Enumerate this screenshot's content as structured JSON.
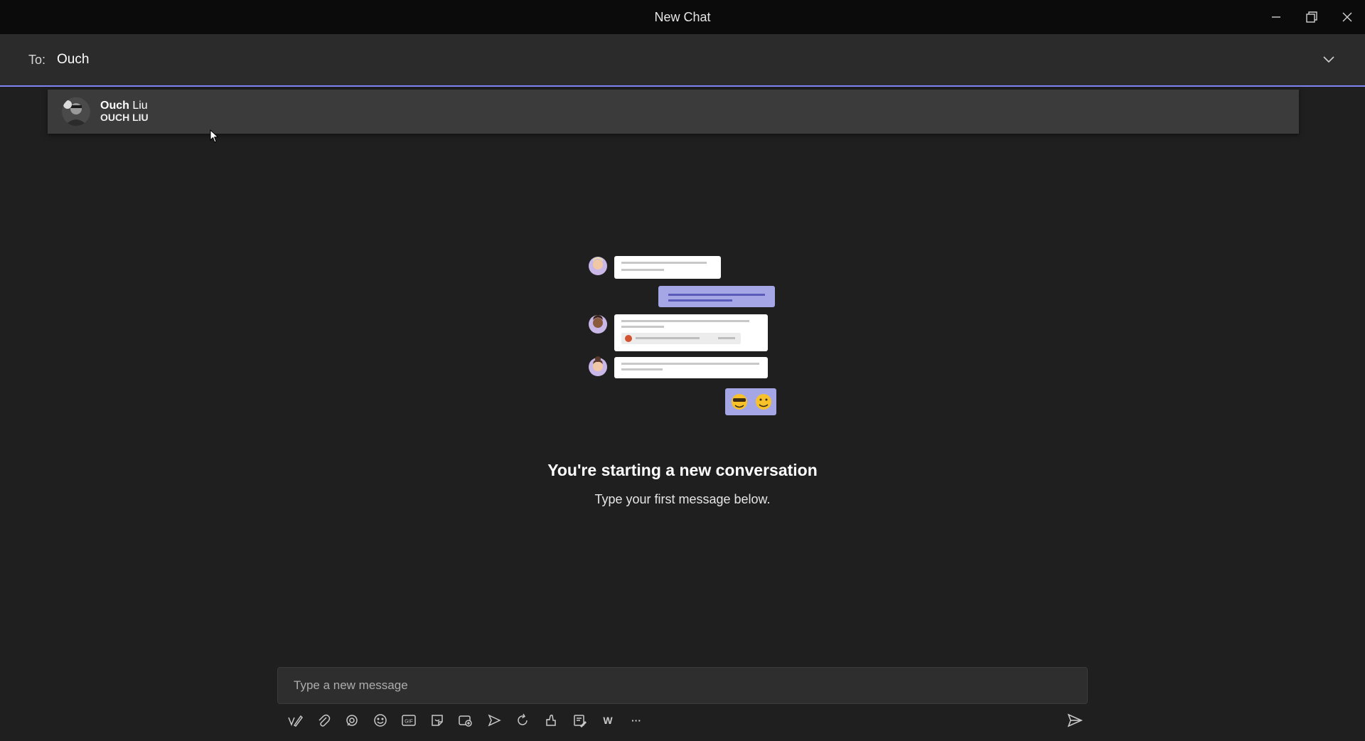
{
  "window": {
    "title": "New Chat"
  },
  "to_bar": {
    "label": "To:",
    "value": "Ouch"
  },
  "suggestion": {
    "name_match": "Ouch",
    "name_rest": " Liu",
    "subtitle": "OUCH LIU"
  },
  "empty_state": {
    "title": "You're starting a new conversation",
    "subtitle": "Type your first message below."
  },
  "composer": {
    "placeholder": "Type a new message"
  },
  "toolbar": {
    "icons": [
      "format-icon",
      "attach-icon",
      "loop-icon",
      "emoji-icon",
      "gif-icon",
      "sticker-icon",
      "meet-now-icon",
      "stream-icon",
      "praise-icon",
      "schedule-icon",
      "approvals-icon",
      "wiki-icon",
      "more-icon"
    ],
    "gif_label": "GIF",
    "wiki_label": "W",
    "more_label": "···"
  },
  "colors": {
    "accent": "#7f85f5",
    "background": "#1f1f1f",
    "titlebar": "#0b0b0b"
  }
}
